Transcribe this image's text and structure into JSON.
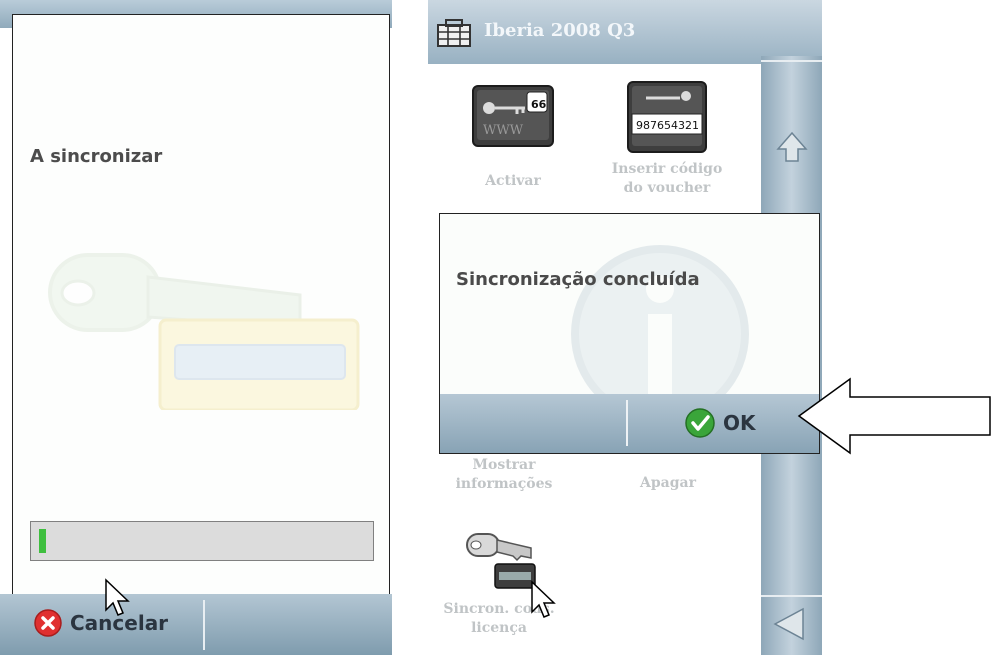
{
  "left_screen": {
    "status_title": "A sincronizar",
    "progress_fraction": 0.02,
    "cancel_label": "Cancelar"
  },
  "right_screen": {
    "map_title": "Iberia 2008 Q3",
    "menu_items": [
      {
        "label_line1": "Activar",
        "label_line2": ""
      },
      {
        "label_line1": "Inserir código",
        "label_line2": "do voucher"
      },
      {
        "label_line1": "Mostrar",
        "label_line2": "informações"
      },
      {
        "label_line1": "Apagar",
        "label_line2": ""
      },
      {
        "label_line1": "Sincron. cods.",
        "label_line2": "licença"
      }
    ],
    "voucher_code": "987654321",
    "route_number": "66",
    "dialog": {
      "message": "Sincronização concluída",
      "ok_label": "OK"
    }
  },
  "colors": {
    "progress_green": "#3fbf3f",
    "bar_blue": "#90aabb",
    "cancel_red": "#e03030",
    "ok_green": "#3aa53a"
  },
  "icons": [
    "atlas-icon",
    "key-icon",
    "cancel-icon",
    "ok-check-icon",
    "scroll-up-icon",
    "scroll-left-icon",
    "pointer-cursor-icon",
    "callout-arrow-icon"
  ]
}
